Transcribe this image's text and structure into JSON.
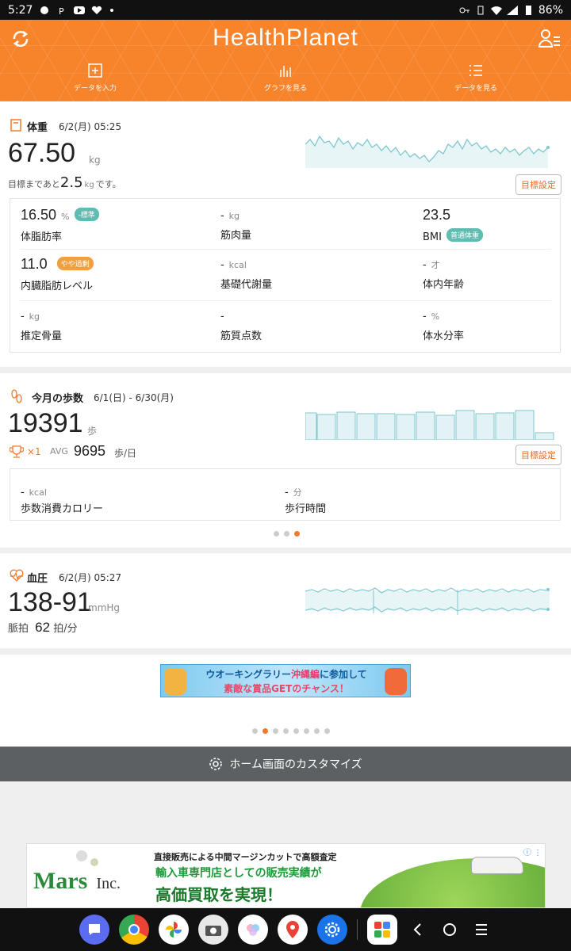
{
  "status_bar": {
    "time": "5:27",
    "battery": "86%"
  },
  "header": {
    "app_title": "HealthPlanet",
    "nav": [
      {
        "label": "データを入力"
      },
      {
        "label": "グラフを見る"
      },
      {
        "label": "データを見る"
      }
    ]
  },
  "weight": {
    "title": "体重",
    "date": "6/2(月) 05:25",
    "value": "67.50",
    "unit": "kg",
    "goal_prefix": "目標まであと",
    "goal_value": "2.5",
    "goal_unit": "kg",
    "goal_suffix": "です。",
    "goal_button": "目標設定",
    "metrics": [
      {
        "value": "16.50",
        "unit": "%",
        "label": "体脂肪率",
        "badge": "-標準",
        "badge_color": "#5dbdb0"
      },
      {
        "value": "-",
        "unit": "kg",
        "label": "筋肉量"
      },
      {
        "value": "23.5",
        "unit": "",
        "label": "BMI",
        "badge": "普通体重",
        "badge_color": "#5dbdb0"
      },
      {
        "value": "11.0",
        "unit": "",
        "label": "内臓脂肪レベル",
        "badge": "やや過剰",
        "badge_color": "#f0a040"
      },
      {
        "value": "-",
        "unit": "kcal",
        "label": "基礎代謝量"
      },
      {
        "value": "-",
        "unit": "才",
        "label": "体内年齢"
      },
      {
        "value": "-",
        "unit": "kg",
        "label": "推定骨量"
      },
      {
        "value": "-",
        "unit": "",
        "label": "筋質点数"
      },
      {
        "value": "-",
        "unit": "%",
        "label": "体水分率"
      }
    ]
  },
  "steps": {
    "title": "今月の歩数",
    "date": "6/1(日) - 6/30(月)",
    "value": "19391",
    "unit": "歩",
    "trophy_count": "×1",
    "avg_label": "AVG",
    "avg_value": "9695",
    "avg_unit": "歩/日",
    "goal_button": "目標設定",
    "calorie": {
      "value": "-",
      "unit": "kcal",
      "label": "歩数消費カロリー"
    },
    "walk_time": {
      "value": "-",
      "unit": "分",
      "label": "歩行時間"
    }
  },
  "blood_pressure": {
    "title": "血圧",
    "date": "6/2(月) 05:27",
    "value": "138-91",
    "unit": "mmHg",
    "pulse_label": "脈拍",
    "pulse_value": "62",
    "pulse_unit": "拍/分"
  },
  "banner": {
    "line1_a": "ウオーキングラリー",
    "line1_b": "沖縄編",
    "line1_c": "に参加して",
    "line2": "素敵な賞品GETのチャンス！"
  },
  "customize": {
    "label": "ホーム画面のカスタマイズ"
  },
  "ad": {
    "line1": "直接販売による中間マージンカットで高額査定",
    "line2": "輸入車専門店としての販売実績が",
    "line3": "高価買取を実現！",
    "brand": "Mars",
    "brand_suffix": "Inc."
  },
  "colors": {
    "accent": "#f7832a",
    "chart_line": "#7fc7cf",
    "chart_fill": "#e3f3f5"
  }
}
